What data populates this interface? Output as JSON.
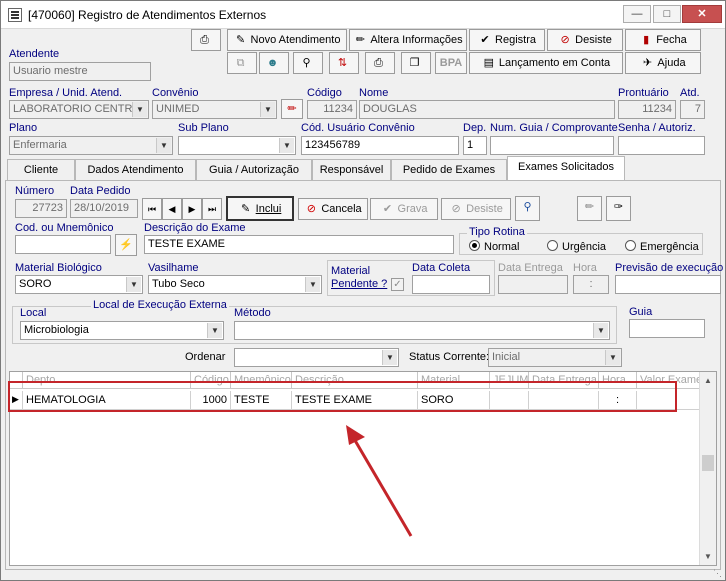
{
  "window": {
    "title": "[470060]   Registro de Atendimentos Externos"
  },
  "toolbar": {
    "novo_atendimento": "Novo Atendimento",
    "altera_informacoes": "Altera Informações",
    "registra": "Registra",
    "desiste": "Desiste",
    "fecha": "Fecha",
    "bpa": "BPA",
    "lancamento_conta": "Lançamento em Conta",
    "ajuda": "Ajuda"
  },
  "header": {
    "atendente_label": "Atendente",
    "atendente_value": "Usuario mestre",
    "empresa_label": "Empresa / Unid. Atend.",
    "empresa_value": "LABORATORIO CENTR.",
    "convenio_label": "Convênio",
    "convenio_value": "UNIMED",
    "codigo_label": "Código",
    "codigo_value": "11234",
    "nome_label": "Nome",
    "nome_value": "DOUGLAS",
    "prontuario_label": "Prontuário",
    "prontuario_value": "11234",
    "atd_label": "Atd.",
    "atd_value": "7",
    "plano_label": "Plano",
    "plano_value": "Enfermaria",
    "subplano_label": "Sub Plano",
    "subplano_value": "",
    "cod_usuario_label": "Cód. Usuário Convênio",
    "cod_usuario_value": "123456789",
    "dep_label": "Dep.",
    "dep_value": "1",
    "num_guia_label": "Num. Guia / Comprovante",
    "num_guia_value": "",
    "senha_label": "Senha / Autoriz.",
    "senha_value": ""
  },
  "tabs": [
    {
      "label": "Cliente"
    },
    {
      "label": "Dados Atendimento"
    },
    {
      "label": "Guia / Autorização"
    },
    {
      "label": "Responsável"
    },
    {
      "label": "Pedido de Exames"
    },
    {
      "label": "Exames Solicitados"
    }
  ],
  "form": {
    "numero_label": "Número",
    "numero_value": "27723",
    "data_pedido_label": "Data Pedido",
    "data_pedido_value": "28/10/2019",
    "inclui_label": "Inclui",
    "cancela_label": "Cancela",
    "grava_label": "Grava",
    "desiste_label": "Desiste",
    "cod_mnemonico_label": "Cod. ou Mnemônico",
    "cod_mnemonico_value": "",
    "descricao_label": "Descrição do Exame",
    "descricao_value": "TESTE EXAME",
    "tipo_rotina_label": "Tipo Rotina",
    "rotina_normal": "Normal",
    "rotina_urgencia": "Urgência",
    "rotina_emergencia": "Emergência",
    "material_label": "Material Biológico",
    "material_value": "SORO",
    "vasilhame_label": "Vasilhame",
    "vasilhame_value": "Tubo Seco",
    "material_pendente_label1": "Material",
    "material_pendente_label2": "Pendente ?",
    "data_coleta_label": "Data Coleta",
    "data_coleta_value": "",
    "data_entrega_label": "Data Entrega",
    "data_entrega_value": "",
    "hora_label": "Hora",
    "hora_value": ":",
    "previsao_label": "Previsão de execução",
    "previsao_value": "",
    "local_exec_title": "Local de Execução Externa",
    "local_label": "Local",
    "local_value": "Microbiologia",
    "metodo_label": "Método",
    "metodo_value": "",
    "guia_label": "Guia",
    "guia_value": "",
    "ordenar_label": "Ordenar",
    "ordenar_value": "",
    "status_label": "Status Corrente:",
    "status_value": "Inicial"
  },
  "grid": {
    "columns": [
      "Depto",
      "Código",
      "Mnemônico",
      "Descrição",
      "Material",
      "JEJUM",
      "Data Entrega",
      "Hora",
      "Valor Exame"
    ],
    "rows": [
      {
        "depto": "HEMATOLOGIA",
        "codigo": "1000",
        "mnemonico": "TESTE",
        "descricao": "TESTE EXAME",
        "material": "SORO",
        "jejum": "",
        "data_entrega": "",
        "hora": ":",
        "valor": ""
      }
    ]
  },
  "colors": {
    "highlight": "#c4252a",
    "label_blue": "#000080"
  }
}
